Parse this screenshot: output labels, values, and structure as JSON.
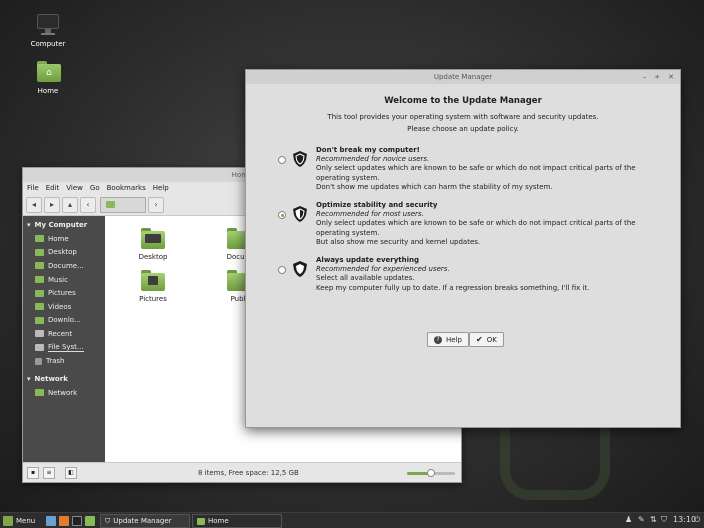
{
  "desktop": {
    "icons": [
      {
        "label": "Computer",
        "icon": "monitor-icon"
      },
      {
        "label": "Home",
        "icon": "home-folder-icon"
      }
    ]
  },
  "file_manager": {
    "title": "Home",
    "menu": [
      "File",
      "Edit",
      "View",
      "Go",
      "Bookmarks",
      "Help"
    ],
    "sidebar": {
      "section_computer": "My Computer",
      "computer_items": [
        "Home",
        "Desktop",
        "Docume...",
        "Music",
        "Pictures",
        "Videos",
        "Downlo...",
        "Recent",
        "File Syst...",
        "Trash"
      ],
      "section_network": "Network",
      "network_items": [
        "Network"
      ]
    },
    "files": [
      "Desktop",
      "Docum",
      "Pictures",
      "Publi"
    ],
    "status": "8 items, Free space: 12,5 GB",
    "zoom_fraction": 0.5
  },
  "update_manager": {
    "title": "Update Manager",
    "heading": "Welcome to the Update Manager",
    "intro_1": "This tool provides your operating system with software and security updates.",
    "intro_2": "Please choose an update policy.",
    "options": [
      {
        "title": "Don't break my computer!",
        "subtitle": "Recommended for novice users.",
        "line1": "Only select updates which are known to be safe or which do not impact critical parts of the operating system.",
        "line2": "Don't show me updates which can harm the stability of my system.",
        "selected": false
      },
      {
        "title": "Optimize stability and security",
        "subtitle": "Recommended for most users.",
        "line1": "Only select updates which are known to be safe or which do not impact critical parts of the operating system.",
        "line2": "But also show me security and kernel updates.",
        "selected": true
      },
      {
        "title": "Always update everything",
        "subtitle": "Recommended for experienced users.",
        "line1": "Select all available updates.",
        "line2": "Keep my computer fully up to date. If a regression breaks something, I'll fix it.",
        "selected": false
      }
    ],
    "help_label": "Help",
    "ok_label": "OK"
  },
  "taskbar": {
    "menu_label": "Menu",
    "windows": [
      "Update Manager",
      "Home"
    ],
    "clock": "13:10"
  },
  "colors": {
    "accent": "#7aa84a",
    "panel": "#2d2d2d",
    "sidebar": "#4a4a4a"
  }
}
